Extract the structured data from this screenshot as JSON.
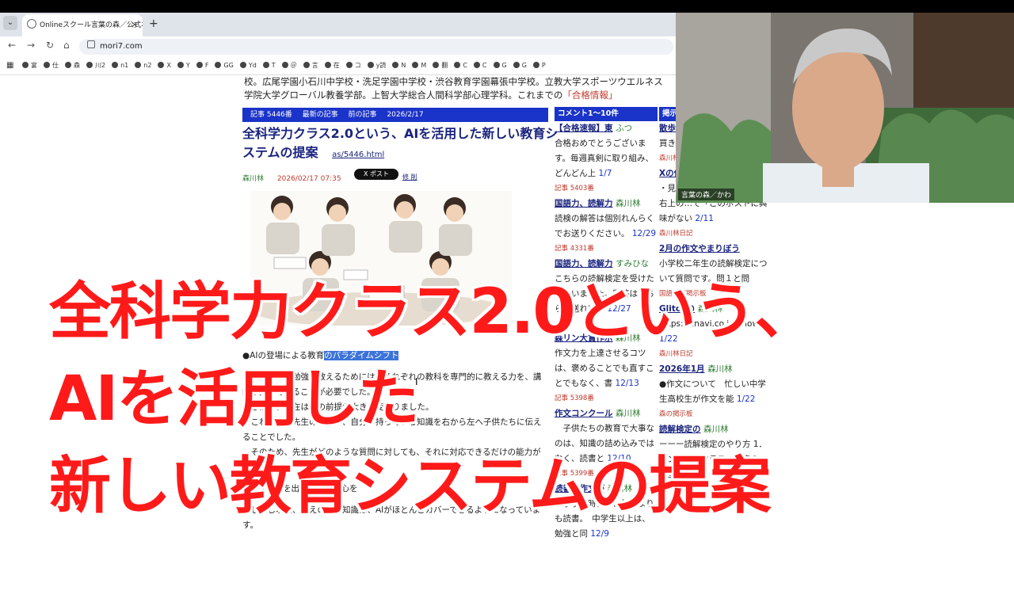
{
  "browser": {
    "tab_title": "Onlineスクール言葉の森／公式ホ",
    "tab_close": "×",
    "new_tab": "+",
    "url": "mori7.com",
    "bookmarks": [
      "宴",
      "仕",
      "森",
      "川2",
      "n1",
      "n2",
      "X",
      "Y",
      "F",
      "GG",
      "Yd",
      "T",
      "＠",
      "言",
      "在",
      "コ",
      "y読",
      "N",
      "M",
      "翻",
      "C",
      "C",
      "G",
      "G",
      "P"
    ]
  },
  "page": {
    "intro_line1": "校。広尾学園小石川中学校・洗足学園中学校・渋谷教育学園幕張中学校。立教大学スポーツウエルネス",
    "intro_line2": "学院大学グローバル教養学部。上智大学総合人間科学部心理学科。これまでの",
    "intro_link": "「合格情報」",
    "article_bar": {
      "number": "記事 5446番",
      "latest": "最新の記事",
      "prev": "前の記事",
      "date": "2026/2/17"
    },
    "article_title": "全科学力クラス2.0という、AIを活用した新しい教育システムの提案",
    "article_link": "as/5446.html",
    "author": "森川林",
    "posted": "2026/02/17 07:35",
    "post_button": "X ポスト",
    "small_links": "修 削",
    "body": {
      "line1_pre": "●AIの登場による教育",
      "line1_hl": "のパラダイムシフト",
      "p1": "　子供たちに勉強を教えるためには、それぞれの教科を専門的に教える力を、講師が持っていることが必要でした。",
      "p2": "　しかし、現在はその前提が大きく変わりました。",
      "p3": "　これまでの先生の役割は、自分の持っている知識を右から左へ子供たちに伝えることでした。",
      "p4": "　そのため、先生がどのような質問に対しても、それに対応できるだけの能力が必要でした。",
      "h2": "●AIが答えを出し、人間が心を",
      "p5": "　しかし現在、答えのある知識は、AIがほとんどカバーできるようになっています。"
    }
  },
  "comments": {
    "header": "コメント1〜10件",
    "items": [
      {
        "title": "【合格速報】東",
        "author": "ふつ",
        "text": "合格おめでとうございます。毎週真剣に取り組み、どんどん上",
        "date": "1/7",
        "num": "記事 5403番"
      },
      {
        "title": "国語力、読解力",
        "author": "森川林",
        "text": "読検の解答は個別れんらくでお送りください。",
        "date": "12/29",
        "num": "記事 4331番"
      },
      {
        "title": "国語力、読解力",
        "author": "すみひな",
        "text": "こちらの読解検定を受けたしまいました。回答はどちらに送ればよ",
        "date": "12/27",
        "num": ""
      },
      {
        "title": "森リン大賞作示",
        "author": "森川林",
        "text": "作文力を上達させるコツは、褒めることでも直すことでもなく、書",
        "date": "12/13",
        "num": "記事 5398番"
      },
      {
        "title": "作文コンクール",
        "author": "森川林",
        "text": "　子供たちの教育で大事なのは、知識の詰め込みではなく、読書と",
        "date": "12/10",
        "num": "記事 5399番"
      },
      {
        "title": "読書と作文が",
        "author": "森川林",
        "text": "　小学生時代は、勉強よりも読書。　中学生以上は、勉強と同",
        "date": "12/9",
        "num": ""
      }
    ]
  },
  "board": {
    "header": "掲示",
    "items": [
      {
        "title": "散歩",
        "author": "",
        "text": "買き、退屈",
        "date": "6",
        "num": "森川林日記"
      },
      {
        "title": "Xの使い方",
        "author": "森川林",
        "text": "・見たくない記事や動画は、右上の…で「このポストに興味がない",
        "date": "2/11",
        "num": "森川林日記"
      },
      {
        "title": "2月の作文やまりぼう",
        "author": "",
        "text": "小学校二年生の読解検定について質問です。問１と問",
        "date": "",
        "num": "国語読解掲示板"
      },
      {
        "title": "Glitchの",
        "author": "森川林",
        "text": "https://hnavi.co.jp/knowledge/",
        "date": "1/22",
        "num": "森川林日記"
      },
      {
        "title": "2026年1月",
        "author": "森川林",
        "text": "●作文について　忙しい中学生高校生が作文を能",
        "date": "1/22",
        "num": "森の掲示板"
      },
      {
        "title": "読解検定の",
        "author": "森川林",
        "text": "ーーー読解検定のやり方 1．オンラインクラス一覧表の「全",
        "date": "1/16",
        "num": ""
      }
    ]
  },
  "webcam": {
    "label": "言葉の森／かわ"
  },
  "overlay": {
    "line1": "全科学力クラス2.0という、",
    "line2": "AIを活用した",
    "line3": "新しい教育システムの提案"
  }
}
